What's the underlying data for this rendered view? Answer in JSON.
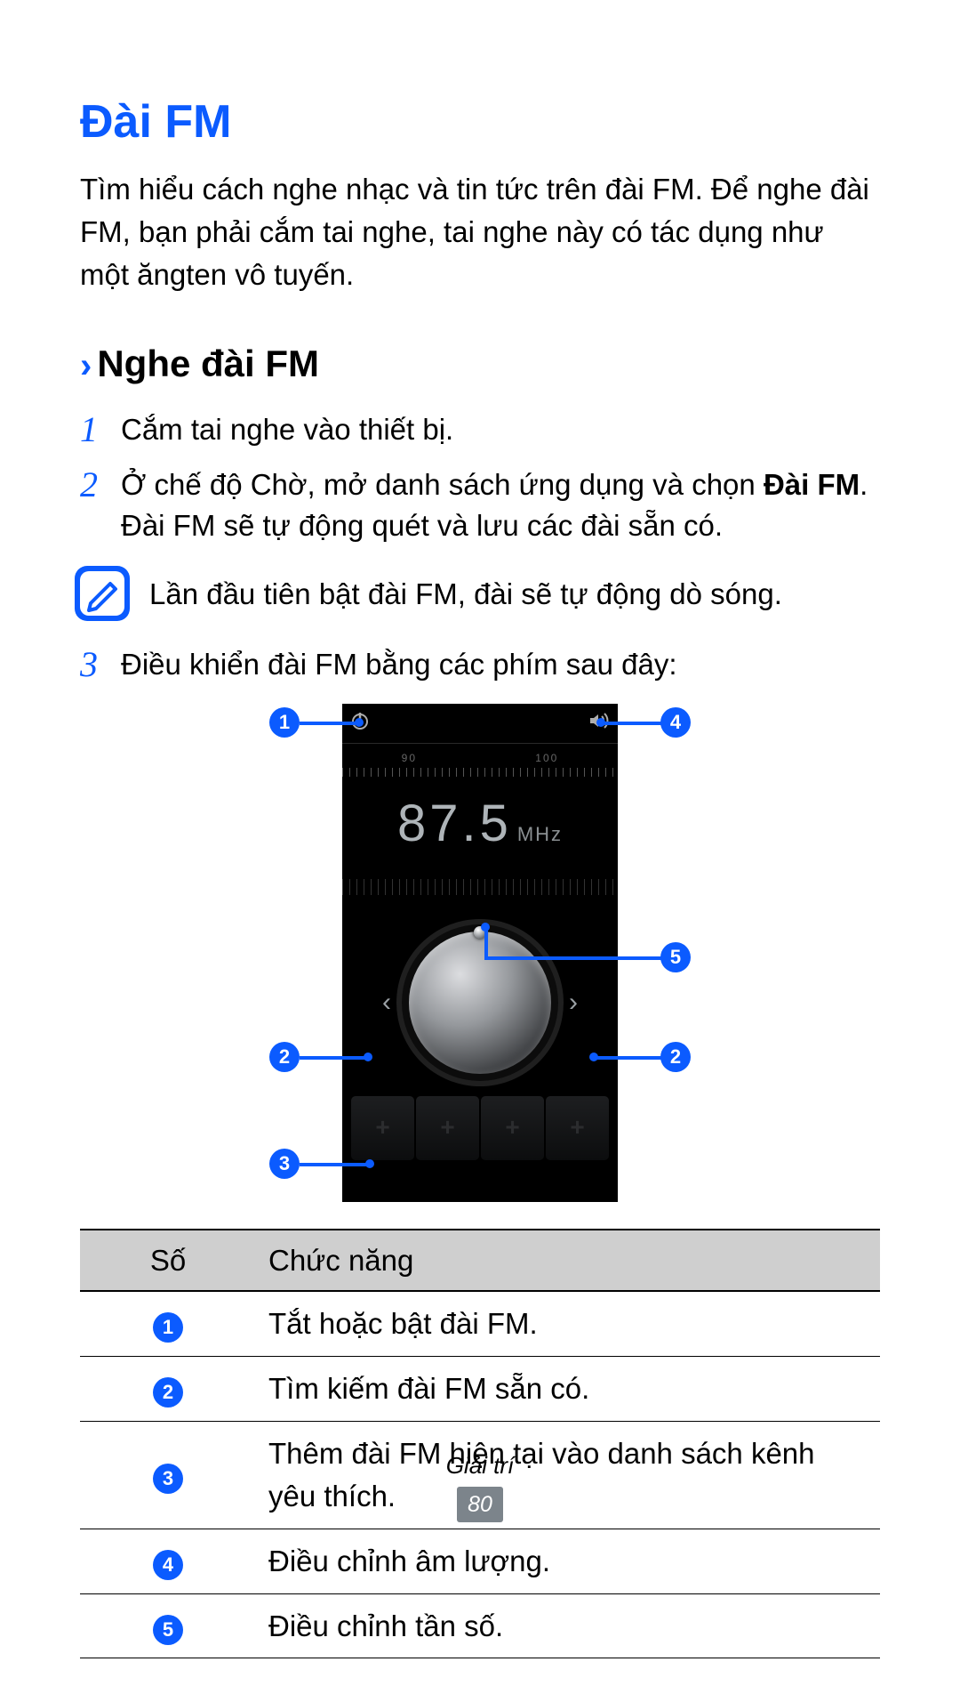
{
  "h1": "Đài FM",
  "intro": "Tìm hiểu cách nghe nhạc và tin tức trên đài FM. Để nghe đài FM, bạn phải cắm tai nghe, tai nghe này có tác dụng như một ăngten vô tuyến.",
  "section": {
    "chevron": "›",
    "title": "Nghe đài FM"
  },
  "steps": [
    {
      "num": "1",
      "text": "Cắm tai nghe vào thiết bị."
    },
    {
      "num": "2",
      "text_pre": "Ở chế độ Chờ, mở danh sách ứng dụng và chọn ",
      "text_bold": "Đài FM",
      "text_post": ".\nĐài FM sẽ tự động quét và lưu các đài sẵn có."
    },
    {
      "num": "3",
      "text": "Điều khiển đài FM bằng các phím sau đây:"
    }
  ],
  "note": "Lần đầu tiên bật đài FM, đài sẽ tự động dò sóng.",
  "radio": {
    "scale": [
      "90",
      "100"
    ],
    "freq": "87.5",
    "unit": "MHz",
    "fav_glyph": "+",
    "arrow_left": "‹",
    "arrow_right": "›"
  },
  "callouts": {
    "c1": "1",
    "c2": "2",
    "c3": "3",
    "c4": "4",
    "c5": "5"
  },
  "table": {
    "head": {
      "num": "Số",
      "func": "Chức năng"
    },
    "rows": [
      {
        "n": "1",
        "f": "Tắt hoặc bật đài FM."
      },
      {
        "n": "2",
        "f": "Tìm kiếm đài FM sẵn có."
      },
      {
        "n": "3",
        "f": "Thêm đài FM hiện tại vào danh sách kênh yêu thích."
      },
      {
        "n": "4",
        "f": "Điều chỉnh âm lượng."
      },
      {
        "n": "5",
        "f": "Điều chỉnh tần số."
      }
    ]
  },
  "footer": {
    "section": "Giải trí",
    "page": "80"
  }
}
